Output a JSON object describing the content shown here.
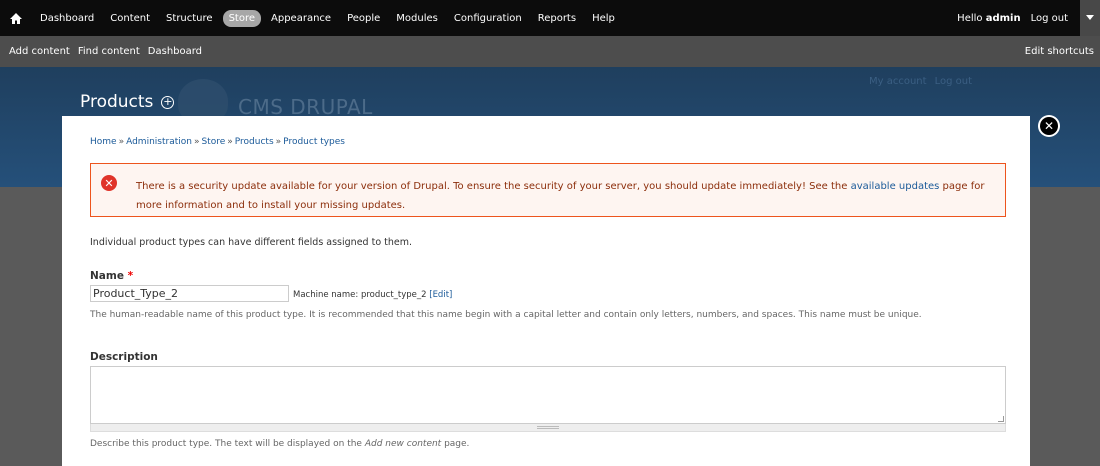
{
  "toolbar": {
    "menu_items": [
      "Dashboard",
      "Content",
      "Structure",
      "Store",
      "Appearance",
      "People",
      "Modules",
      "Configuration",
      "Reports",
      "Help"
    ],
    "active_item": "Store",
    "hello_prefix": "Hello ",
    "username": "admin",
    "logout": "Log out",
    "shortcuts": [
      "Add content",
      "Find content",
      "Dashboard"
    ],
    "edit_shortcuts": "Edit shortcuts"
  },
  "header": {
    "page_title": "Products",
    "site_name": "CMS DRUPAL",
    "secondary_links": [
      "My account",
      "Log out"
    ]
  },
  "breadcrumb": [
    "Home",
    "Administration",
    "Store",
    "Products",
    "Product types"
  ],
  "breadcrumb_separator": "»",
  "message": {
    "text_before": "There is a security update available for your version of Drupal. To ensure the security of your server, you should update immediately! See the ",
    "link": "available updates",
    "text_after": " page for more information and to install your missing updates."
  },
  "intro": "Individual product types can have different fields assigned to them.",
  "name_field": {
    "label": "Name",
    "required_mark": "*",
    "value": "Product_Type_2",
    "machine_prefix": "Machine name: product_type_2 ",
    "machine_edit": "[Edit]",
    "description": "The human-readable name of this product type. It is recommended that this name begin with a capital letter and contain only letters, numbers, and spaces. This name must be unique."
  },
  "description_field": {
    "label": "Description",
    "value": "",
    "help_before": "Describe this product type. The text will be displayed on the ",
    "help_em": "Add new content",
    "help_after": " page."
  },
  "colors": {
    "toolbar_bg": "#0c0c0c",
    "shortcut_bg": "#4d4d4d",
    "header_bg": "#25507a",
    "error_border": "#ed541d",
    "error_text": "#8c2e0b",
    "link": "#1b5a99"
  },
  "icons": {
    "home": "home-icon",
    "add_shortcut": "plus-circle-icon",
    "close": "close-icon",
    "error": "error-icon",
    "drawer": "chevron-down-icon"
  }
}
